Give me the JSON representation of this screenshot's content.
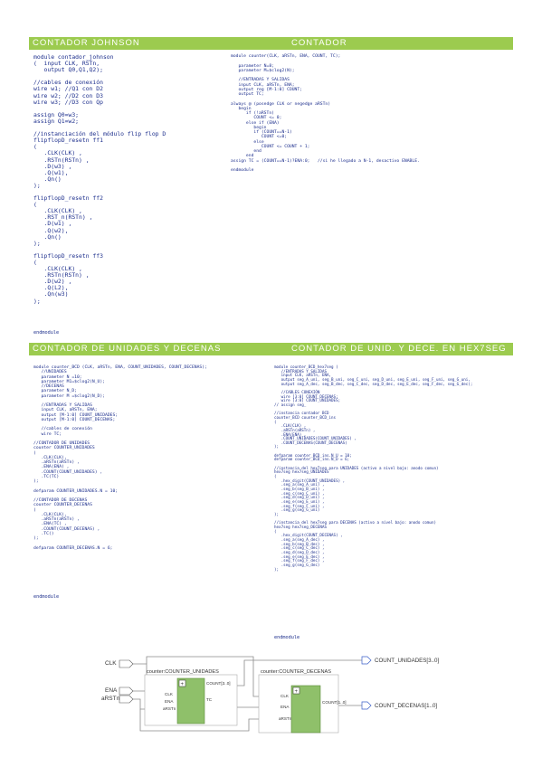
{
  "sections": {
    "johnson": {
      "title": "CONTADOR JOHNSON",
      "code": "module contador_johnson\n(  input CLK, RSTn,\n   output Q0,Q1,Q2);\n\n//cables de conexión\nwire w1; //Q1 con D2\nwire w2; //D2 con D3\nwire w3; //D3 con Qp\n\nassign Q0=w3;\nassign Q1=w2;\n\n//instanciación del módulo flip flop D\nflipflopD_resetn ff1\n(\n   .CLK(CLK) ,\n   .RSTn(RSTn) ,\n   .D(w3) ,\n   .Q(w1),\n   .Qn()\n);\n\nflipflopD_resetn ff2\n(\n   .CLK(CLK) ,\n   .RST_n(RSTn) ,\n   .D(w1) ,\n   .Q(w2),\n   .Qn()\n);\n\nflipflopD_resetn ff3\n(\n   .CLK(CLK) ,\n   .RSTn(RSTn) ,\n   .D(w2) ,\n   .Q(L2),\n   .Qn(w3)\n);",
      "end": "endmodule"
    },
    "contador": {
      "title": "CONTADOR",
      "code": "module counter(CLK, aRSTn, ENA, COUNT, TC);\n\n   parameter N=8;\n   parameter M=$clog2(N);\n\n   //ENTRADAS Y SALIDAS\n   input CLK, aRSTn, ENA;\n   output reg [M-1:0] COUNT;\n   output TC;\n\nalways @ (posedge CLK or negedge aRSTn)\n   begin\n      if (!aRSTn)\n         COUNT <= 0;\n      else if (ENA)\n         begin\n         if (COUNT==N-1)\n            COUNT <=0;\n         else\n            COUNT <= COUNT + 1;\n         end\n      end\nassign TC = (COUNT==N-1)?ENA:0;   //si he llegado a N-1, desactivo ENABLE.\n\nendmodule"
    },
    "decenas": {
      "title": "CONTADOR DE UNIDADES Y DECENAS",
      "code": "module counter_BCD (CLK, aRSTn, ENA, COUNT_UNIDADES, COUNT_DECENAS);\n   //UNIDADES\n   parameter N =10;\n   parameter M1=$clog2(N_U);\n   //DECENAS\n   parameter N_D;\n   parameter M =$clog2(N_D);\n\n   //ENTRADAS Y SALIDAS\n   input CLK, aRSTn, ENA;\n   output [M-1:0] COUNT_UNIDADES;\n   output [M-1:0] COUNT_DECENAS;\n\n   //cables de conexión\n   wire TC;\n\n//CONTADOR DE UNIDADES\ncounter COUNTER_UNIDADES\n(\n   .CLK(CLK),\n   .aRSTn(aRSTn) ,\n   .ENA(ENA) ,\n   .COUNT(COUNT_UNIDADES) ,\n   .TC(TC)\n);\n\ndefparam COUNTER_UNIDADES.N = 10;\n\n//CONTADOR DE DECENAS\ncounter COUNTER_DECENAS\n(\n   .CLK(CLK),\n   .aRSTn(aRSTn) ,\n   .ENA(TC) ,\n   .COUNT(COUNT_DECENAS) ,\n   .TC()\n);\n\ndefparam COUNTER_DECENAS.N = 6;",
      "end": "endmodule"
    },
    "hex": {
      "title": "CONTADOR DE UNID. Y DECE. EN HEX7SEG",
      "code": "module counter_BCD_hex7seg (\n   //ENTRADAS Y SALIDAS\n   input CLK, aRSTn, ENA,\n   output seg_A_uni, seg_B_uni, seg_C_uni, seg_D_uni, seg_E_uni, seg_F_uni, seg_G_uni,\n   output seg_A_dec, seg_B_dec, seg_C_dec, seg_D_dec, seg_E_dec, seg_F_dec, seg_G_dec);\n\n   //CABLES CONEXIÓN\n   wire [3:0] COUNT_DECENAS;\n   wire [3:0] COUNT_UNIDADES;\n// assign seg_\n\n//instancia contador BCD\ncounter_BCD counter_BCD_ins\n(\n   .CLK(CLK) ,\n   .aRSTn(aRSTn) ,\n   .ENA(ENA) ,\n   .COUNT_UNIDADES(COUNT_UNIDADES) ,\n   .COUNT_DECENAS(COUNT_DECENAS)\n);\n\ndefparam counter_BCD_ins.N_U = 10;\ndefparam counter_BCD_ins.N_D = 6;\n\n//instancia del hex7seg para UNIDADES (activo a nivel bajo: anodo comun)\nhex7seg hex7seg_UNIDADES\n(\n   .hex_digit(COUNT_UNIDADES) ,\n   .seg_a(seg_A_uni) ,\n   .seg_b(seg_B_uni) ,\n   .seg_c(seg_C_uni) ,\n   .seg_d(seg_D_uni) ,\n   .seg_e(seg_E_uni) ,\n   .seg_f(seg_F_uni) ,\n   .seg_g(seg_G_uni)\n);\n\n//instancia del hex7seg para DECENAS (activo a nivel bajo: anodo comun)\nhex7seg hex7seg_DECENAS\n(\n   .hex_digit(COUNT_DECENAS) ,\n   .seg_a(seg_A_dec) ,\n   .seg_b(seg_B_dec) ,\n   .seg_c(seg_C_dec) ,\n   .seg_d(seg_D_dec) ,\n   .seg_e(seg_E_dec) ,\n   .seg_f(seg_F_dec) ,\n   .seg_g(seg_G_dec)\n);",
      "end": "endmodule"
    }
  },
  "diagram": {
    "inputs": [
      "CLK",
      "ENA",
      "aRSTn"
    ],
    "block1": {
      "name": "counter:COUNTER_UNIDADES",
      "ports_in": [
        "CLK",
        "ENA",
        "aRSTn"
      ],
      "ports_out": [
        "COUNT[3..0]",
        "TC"
      ]
    },
    "block2": {
      "name": "counter:COUNTER_DECENAS",
      "ports_in": [
        "CLK",
        "ENA",
        "aRSTn"
      ],
      "ports_out": [
        "COUNT[1..0]"
      ]
    },
    "outputs": [
      "COUNT_UNIDADES[3..0]",
      "COUNT_DECENAS[1..0]"
    ],
    "colors": {
      "header": "#9ccb4f",
      "block": "#8fc06a",
      "code": "#1c2e8c",
      "wire": "#8a8a8a"
    }
  }
}
